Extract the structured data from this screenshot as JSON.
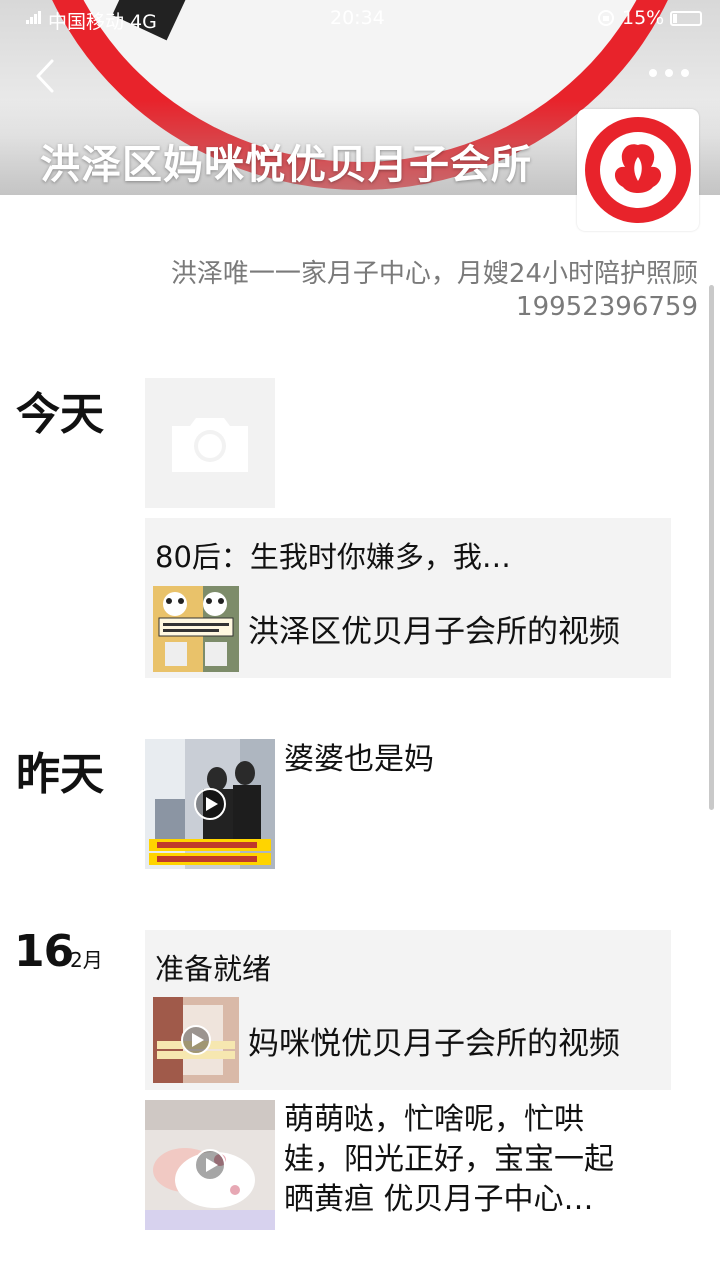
{
  "status_bar": {
    "carrier": "中国移动  4G",
    "time": "20:34",
    "battery": "15%"
  },
  "header": {
    "title": "洪泽区妈咪悦优贝月子会所",
    "back_icon": "back-chevron-icon",
    "more_icon": "more-dots-icon",
    "brand_color": "#e8232b"
  },
  "profile": {
    "signature_line1": "洪泽唯一一家月子中心，月嫂24小时陪护照顾",
    "signature_line2": "19952396759"
  },
  "timeline": {
    "today": {
      "label": "今天",
      "share": {
        "title": "80后：生我时你嫌多，我…",
        "link_text": "洪泽区优贝月子会所的视频"
      }
    },
    "yesterday": {
      "label": "昨天",
      "post_text": "婆婆也是妈"
    },
    "feb16": {
      "day": "16",
      "month": "2月",
      "share": {
        "title": "准备就绪",
        "link_text": "妈咪悦优贝月子会所的视频"
      },
      "post_line1": "萌萌哒，忙啥呢，忙哄",
      "post_line2": "娃，阳光正好，宝宝一起",
      "post_line3": "晒黄疸      优贝月子中心…"
    }
  }
}
